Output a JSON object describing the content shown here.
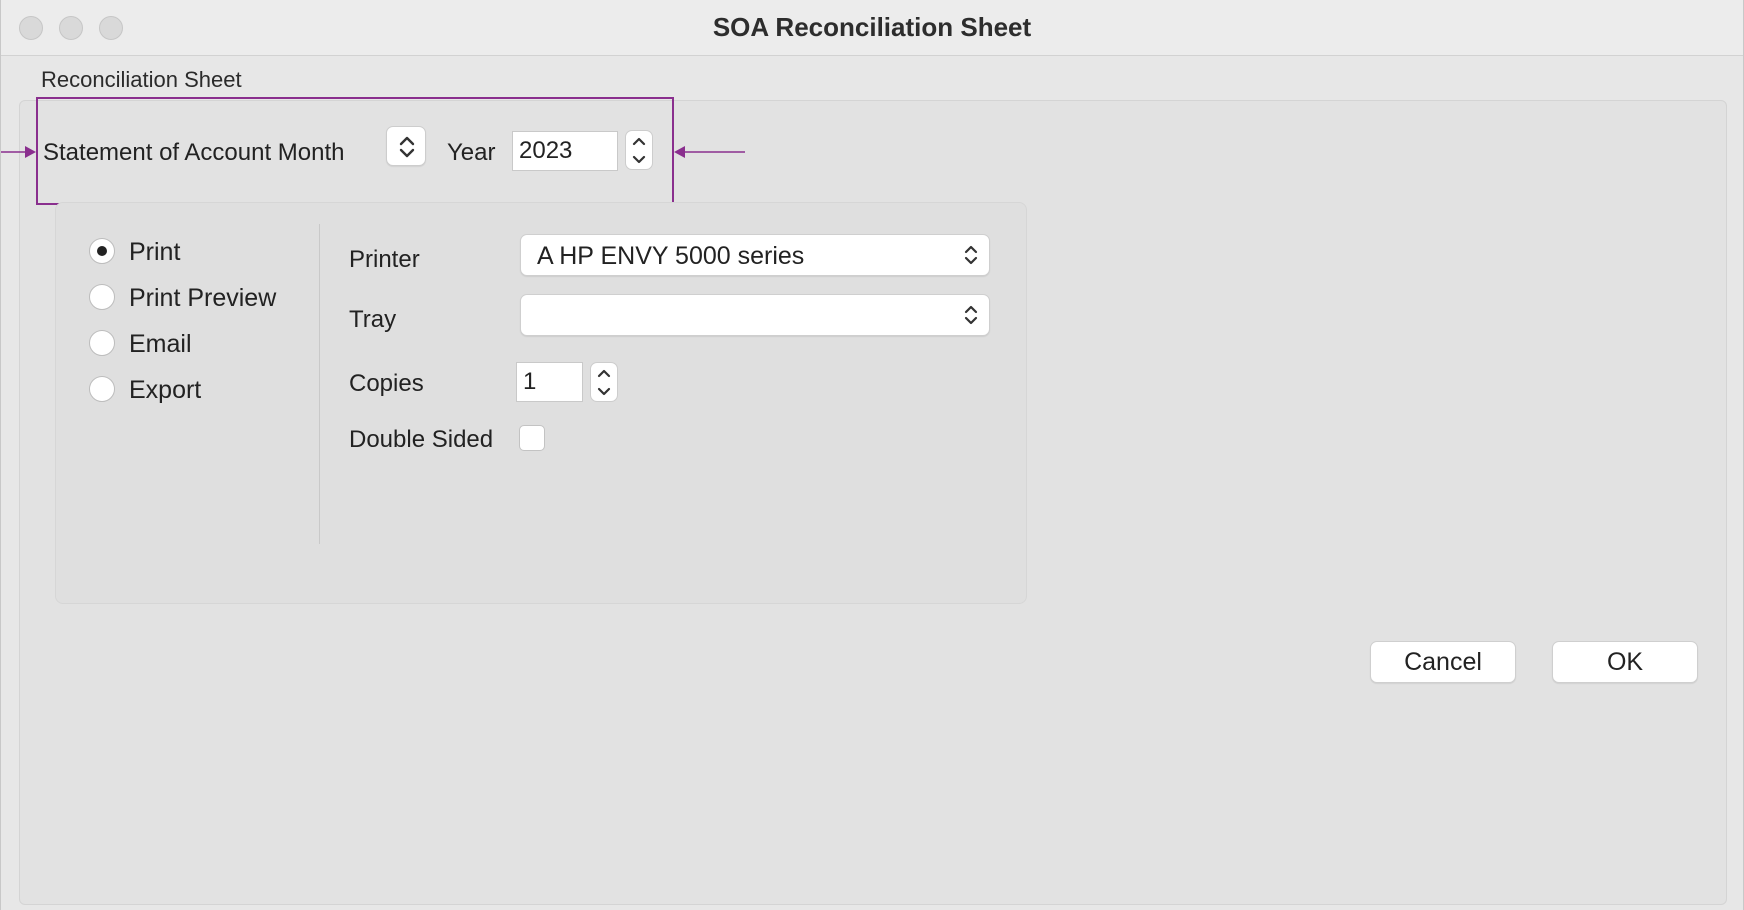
{
  "window": {
    "title": "SOA Reconciliation Sheet"
  },
  "group": {
    "label": "Reconciliation Sheet"
  },
  "period": {
    "month_label": "Statement of Account Month",
    "year_label": "Year",
    "year_value": "2023"
  },
  "output": {
    "options": [
      {
        "label": "Print",
        "selected": true
      },
      {
        "label": "Print Preview",
        "selected": false
      },
      {
        "label": "Email",
        "selected": false
      },
      {
        "label": "Export",
        "selected": false
      }
    ]
  },
  "printer": {
    "printer_label": "Printer",
    "printer_value": "A HP ENVY 5000 series",
    "tray_label": "Tray",
    "tray_value": "",
    "copies_label": "Copies",
    "copies_value": "1",
    "double_sided_label": "Double Sided",
    "double_sided_checked": false
  },
  "buttons": {
    "cancel": "Cancel",
    "ok": "OK"
  },
  "colors": {
    "annotation": "#8a2f8e",
    "window_bg": "#e7e7e7"
  }
}
